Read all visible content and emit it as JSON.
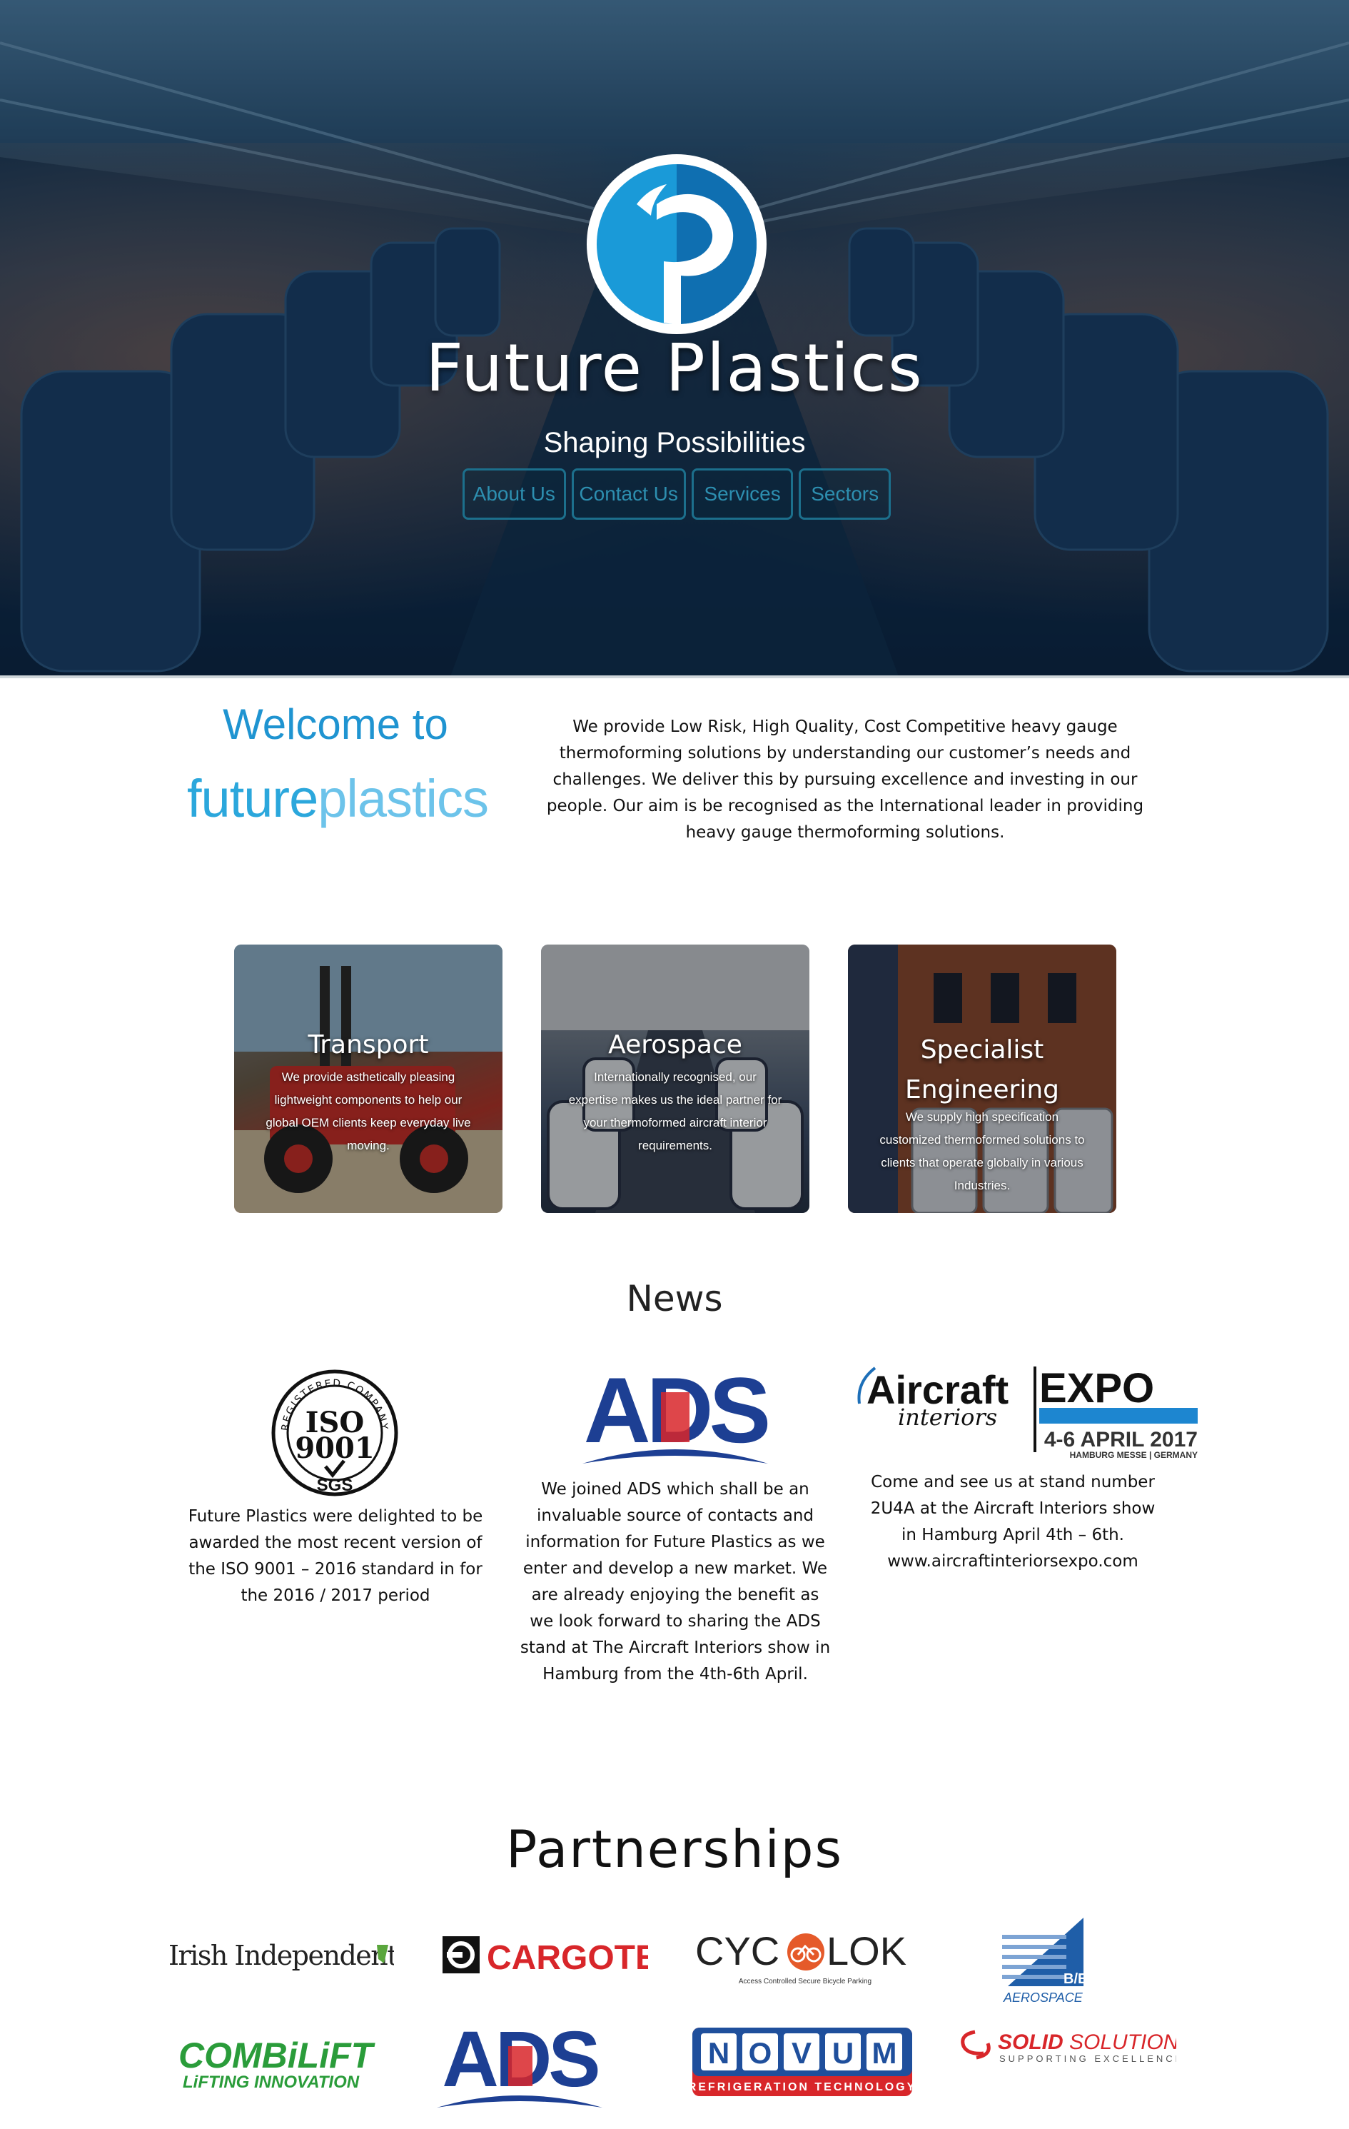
{
  "hero": {
    "title": "Future Plastics",
    "tagline": "Shaping Possibilities",
    "nav": [
      "About Us",
      "Contact Us",
      "Services",
      "Sectors"
    ]
  },
  "welcome": {
    "heading": "Welcome to",
    "logo_part1": "future",
    "logo_part2": "plastics",
    "text": "We provide Low Risk, High Quality, Cost Competitive heavy gauge thermoforming solutions by understanding our customer’s needs and challenges. We deliver this by pursuing excellence and investing in our people. Our aim is be recognised as the International leader in providing heavy gauge thermoforming solutions."
  },
  "sectors": [
    {
      "title": "Transport",
      "desc": "We provide asthetically pleasing lightweight components to help our global OEM clients keep everyday live moving."
    },
    {
      "title": "Aerospace",
      "desc": "Internationally recognised, our expertise makes us the ideal partner for your thermoformed aircraft interior requirements."
    },
    {
      "title": "Specialist Engineering",
      "desc": "We supply high specification customized thermoformed solutions to clients that operate globally in various Industries."
    }
  ],
  "news": {
    "heading": "News",
    "items": [
      {
        "logo_text_1": "REGISTERED COMPANY",
        "logo_text_2": "ISO",
        "logo_text_3": "9001",
        "logo_text_4": "SGS",
        "text": "Future Plastics were delighted to be awarded the most recent version of the ISO 9001 – 2016 standard in for the 2016 / 2017 period"
      },
      {
        "logo_text_1": "ADS",
        "text": "We joined ADS which shall be an invaluable source of contacts and information for Future Plastics as we enter and develop a new market. We are already enjoying the benefit as we look forward to sharing the ADS stand at The Aircraft Interiors show in Hamburg from the 4th-6th April."
      },
      {
        "logo_text_1": "Aircraft",
        "logo_text_2": "interiors",
        "logo_text_3": "EXPO",
        "logo_text_4": "4-6 APRIL 2017",
        "logo_text_5": "HAMBURG MESSE | GERMANY",
        "text": "Come and see us at stand number 2U4A at the Aircraft Interiors show in Hamburg April 4th – 6th. www.aircraftinteriorsexpo.com"
      }
    ]
  },
  "partnerships": {
    "heading": "Partnerships",
    "logos": {
      "irish_independent": "Irish Independent",
      "cargotec": "CARGOTEC",
      "cycolok_1": "CYC",
      "cycolok_2": "LOK",
      "cycolok_sub": "Access Controlled Secure Bicycle Parking",
      "be_aerospace_1": "B/E",
      "be_aerospace_2": "AEROSPACE",
      "combilift_1": "COMBiLiFT",
      "combilift_2": "LiFTING INNOVATION",
      "ads": "ADS",
      "novum_letters": [
        "N",
        "O",
        "V",
        "U",
        "M"
      ],
      "novum_sub": "REFRIGERATION TECHNOLOGY",
      "solid_1": "SOLID",
      "solid_2": "SOLUTIONS",
      "solid_sub": "SUPPORTING EXCELLENCE"
    }
  },
  "colors": {
    "brand_blue": "#1f94d1",
    "nav_border": "#1c6f8c",
    "cargotec_red": "#d8262a",
    "combilift_green": "#2a9c3a",
    "ads_blue": "#1d3f93",
    "ads_red": "#d8262a",
    "novum_blue": "#1f4f9c"
  }
}
